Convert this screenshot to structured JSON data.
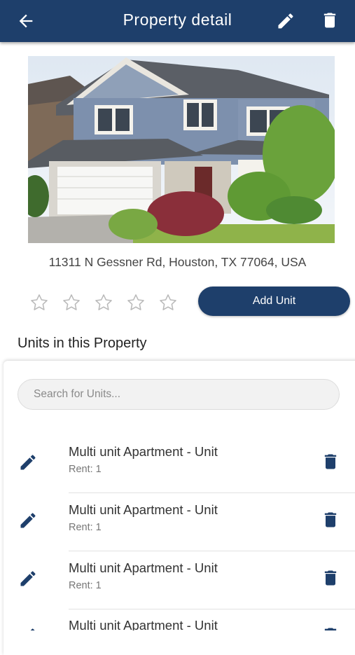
{
  "header": {
    "title": "Property detail"
  },
  "property": {
    "address": "11311 N Gessner Rd, Houston, TX 77064, USA",
    "rating": 0,
    "rating_max": 5
  },
  "actions": {
    "add_unit_label": "Add Unit"
  },
  "units_section": {
    "title": "Units in this Property",
    "search_placeholder": "Search for Units..."
  },
  "units": [
    {
      "title": "Multi unit Apartment - Unit",
      "rent": "Rent: 1"
    },
    {
      "title": "Multi unit Apartment - Unit",
      "rent": "Rent: 1"
    },
    {
      "title": "Multi unit Apartment - Unit",
      "rent": "Rent: 1"
    },
    {
      "title": "Multi unit Apartment - Unit",
      "rent": ""
    }
  ],
  "colors": {
    "primary": "#1e3f6b",
    "background": "#ffffff"
  },
  "icons": [
    "back-arrow-icon",
    "pencil-icon",
    "trash-icon",
    "star-outline-icon"
  ]
}
